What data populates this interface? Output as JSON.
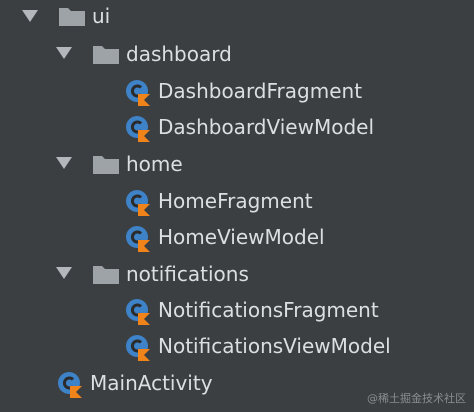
{
  "tree": {
    "root_folder": "ui",
    "folders": [
      {
        "name": "dashboard",
        "files": [
          "DashboardFragment",
          "DashboardViewModel"
        ]
      },
      {
        "name": "home",
        "files": [
          "HomeFragment",
          "HomeViewModel"
        ]
      },
      {
        "name": "notifications",
        "files": [
          "NotificationsFragment",
          "NotificationsViewModel"
        ]
      }
    ],
    "root_file": "MainActivity"
  },
  "watermark": "@稀土掘金技术社区",
  "colors": {
    "background": "#3c3f41",
    "text": "#dcdfe2",
    "folder": "#9ea3a8",
    "class_icon_bg": "#3e82c8",
    "kotlin_orange": "#f0831a"
  }
}
